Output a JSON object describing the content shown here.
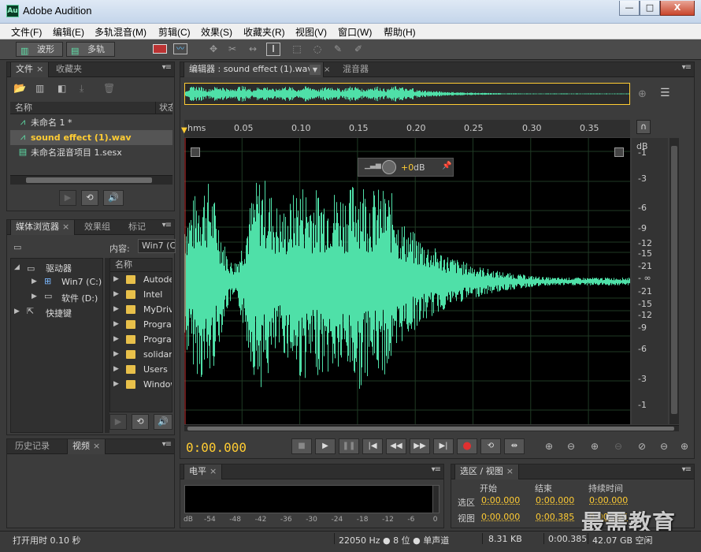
{
  "window": {
    "app_icon": "Au",
    "title": "Adobe Audition",
    "minimize": "—",
    "maximize": "□",
    "close": "X"
  },
  "menu": [
    "文件(F)",
    "编辑(E)",
    "多轨混音(M)",
    "剪辑(C)",
    "效果(S)",
    "收藏夹(R)",
    "视图(V)",
    "窗口(W)",
    "帮助(H)"
  ],
  "toolbar": {
    "waveform_label": "波形",
    "multitrack_label": "多轨"
  },
  "files_panel": {
    "tabs": [
      "文件",
      "收藏夹"
    ],
    "columns": [
      "名称",
      "状态"
    ],
    "items": [
      {
        "name": "未命名 1 *",
        "icon": "waveform-icon"
      },
      {
        "name": "sound effect (1).wav",
        "icon": "waveform-icon",
        "selected": true
      },
      {
        "name": "未命名混音项目 1.sesx",
        "icon": "multitrack-icon"
      }
    ]
  },
  "media_panel": {
    "tabs": [
      "媒体浏览器",
      "效果组",
      "标记"
    ],
    "content_label": "内容:",
    "content_value": "Win7 (C:",
    "tree": [
      {
        "label": "驱动器",
        "level": 0,
        "expanded": true
      },
      {
        "label": "Win7 (C:)",
        "level": 1
      },
      {
        "label": "软件 (D:)",
        "level": 1
      },
      {
        "label": "快捷键",
        "level": 0
      }
    ],
    "name_header": "名称",
    "folders": [
      "Autode",
      "Intel",
      "MyDriv",
      "Progra",
      "Progra",
      "solidan",
      "Users",
      "Window"
    ]
  },
  "history_panel": {
    "tabs": [
      "历史记录",
      "视频"
    ]
  },
  "status_left": "打开用时 0.10 秒",
  "editor": {
    "tab_title": "编辑器 : sound effect (1).wav",
    "mixer_tab": "混音器",
    "hud_value": "+0",
    "hud_unit": "dB",
    "x_unit": "hms",
    "x_ticks": [
      "0.05",
      "0.10",
      "0.15",
      "0.20",
      "0.25",
      "0.30",
      "0.35"
    ],
    "y_unit": "dB",
    "y_ticks": [
      "-1",
      "-3",
      "-6",
      "-9",
      "-12",
      "-15",
      "-21",
      "- ∞",
      "-21",
      "-15",
      "-12",
      "-9",
      "-6",
      "-3",
      "-1"
    ],
    "current_time": "0:00.000",
    "waveform_color": "#4fe0a8"
  },
  "level_panel": {
    "tab": "电平",
    "unit": "dB",
    "ticks": [
      "-54",
      "-48",
      "-42",
      "-36",
      "-30",
      "-24",
      "-18",
      "-12",
      "-6",
      "0"
    ]
  },
  "selection_panel": {
    "tab": "选区 / 视图",
    "headers": [
      "开始",
      "结束",
      "持续时间"
    ],
    "rows": [
      {
        "label": "选区",
        "start": "0:00.000",
        "end": "0:00.000",
        "duration": "0:00.000"
      },
      {
        "label": "视图",
        "start": "0:00.000",
        "end": "0:00.385",
        "duration": "0:00.385"
      }
    ]
  },
  "status_bar": {
    "sample": "22050 Hz ● 8 位 ● 单声道",
    "size": "8.31 KB",
    "duration": "0:00.385",
    "free": "42.07 GB 空闲"
  },
  "watermark": "最需教育"
}
